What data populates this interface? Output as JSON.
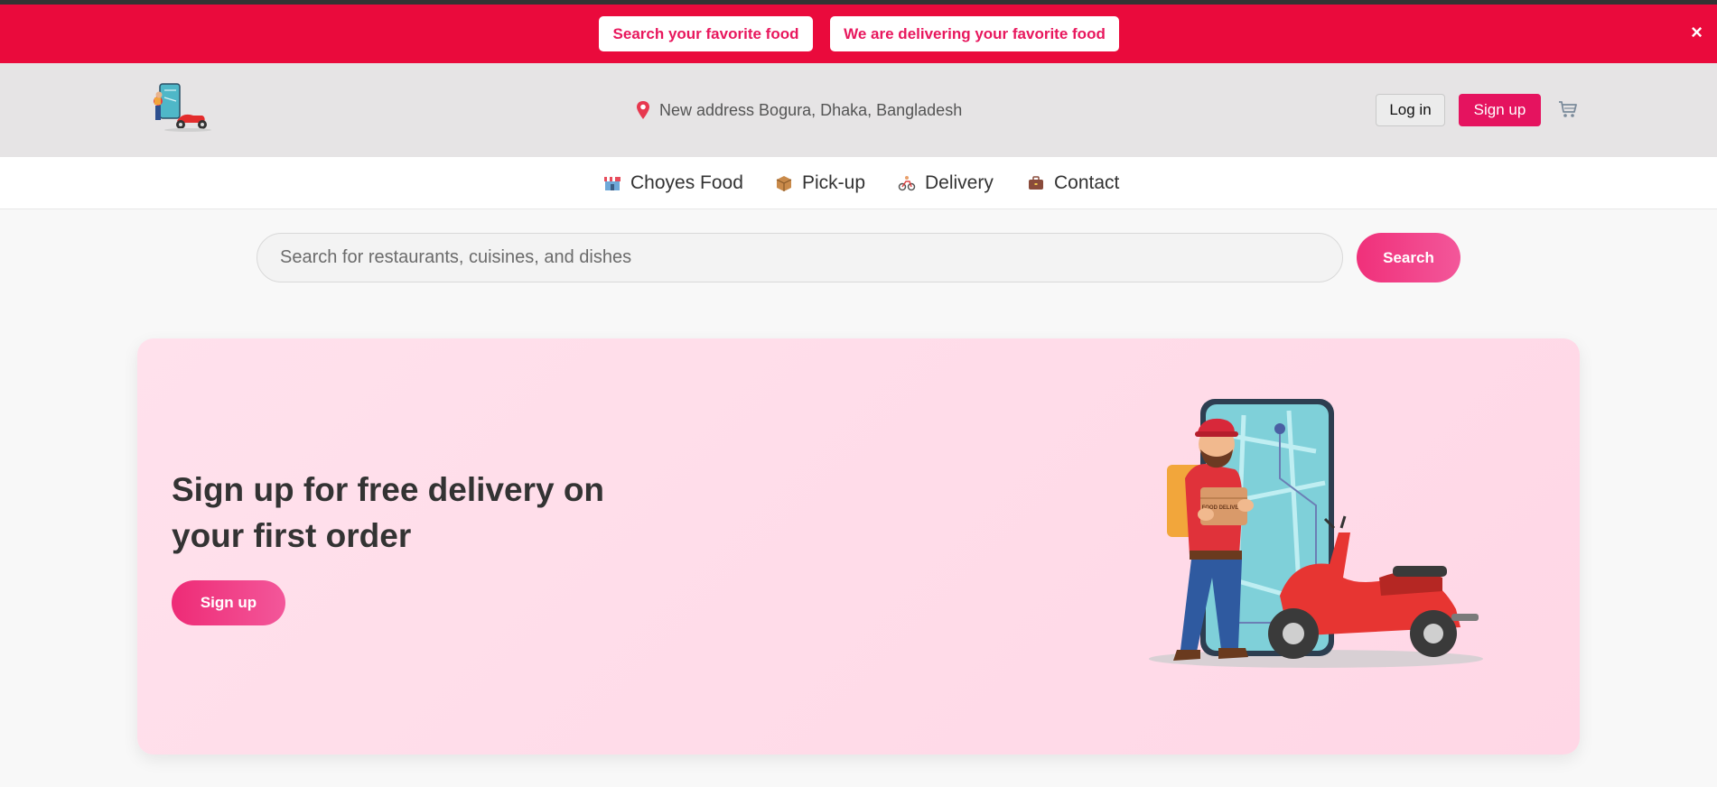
{
  "promo": {
    "pill1": "Search your favorite food",
    "pill2": "We are delivering your favorite food",
    "close": "×"
  },
  "header": {
    "logo_icon": "delivery-scooter-logo",
    "address": "New address Bogura, Dhaka, Bangladesh",
    "login": "Log in",
    "signup": "Sign up",
    "cart_icon": "cart-icon"
  },
  "nav": {
    "items": [
      {
        "label": "Choyes Food",
        "icon": "store-icon"
      },
      {
        "label": "Pick-up",
        "icon": "package-icon"
      },
      {
        "label": "Delivery",
        "icon": "bicycle-icon"
      },
      {
        "label": "Contact",
        "icon": "briefcase-icon"
      }
    ]
  },
  "search": {
    "placeholder": "Search for restaurants, cuisines, and dishes",
    "value": "",
    "button": "Search"
  },
  "hero": {
    "title": "Sign up for free delivery on your first order",
    "button": "Sign up",
    "illustration_text": "FOOD DELIVERY"
  },
  "colors": {
    "promo_bar": "#ea0a3c",
    "accent": "#e5135f",
    "hero_bg": "#ffd9e7"
  }
}
